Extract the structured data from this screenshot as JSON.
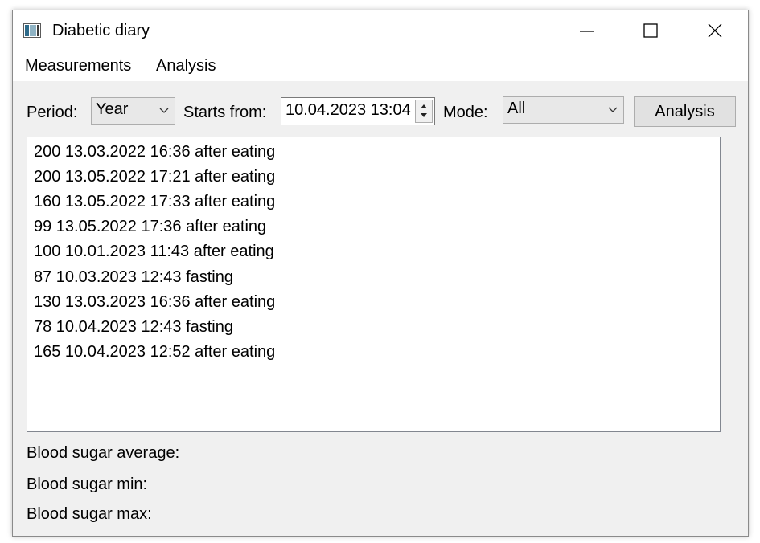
{
  "window": {
    "title": "Diabetic diary"
  },
  "menu": {
    "items": [
      "Measurements",
      "Analysis"
    ]
  },
  "toolbar": {
    "period_label": "Period:",
    "period_value": "Year",
    "starts_label": "Starts from:",
    "starts_value": "10.04.2023 13:04",
    "mode_label": "Mode:",
    "mode_value": "All",
    "analysis_button": "Analysis"
  },
  "measurements": [
    "200 13.03.2022 16:36 after eating",
    "200 13.05.2022 17:21 after eating",
    "160 13.05.2022 17:33 after eating",
    "99 13.05.2022 17:36 after eating",
    "100 10.01.2023 11:43 after eating",
    "87 10.03.2023 12:43 fasting",
    "130 13.03.2023 16:36 after eating",
    "78 10.04.2023 12:43 fasting",
    "165 10.04.2023 12:52 after eating"
  ],
  "stats": {
    "average_label": "Blood sugar average:",
    "min_label": "Blood sugar min:",
    "max_label": "Blood sugar max:"
  }
}
